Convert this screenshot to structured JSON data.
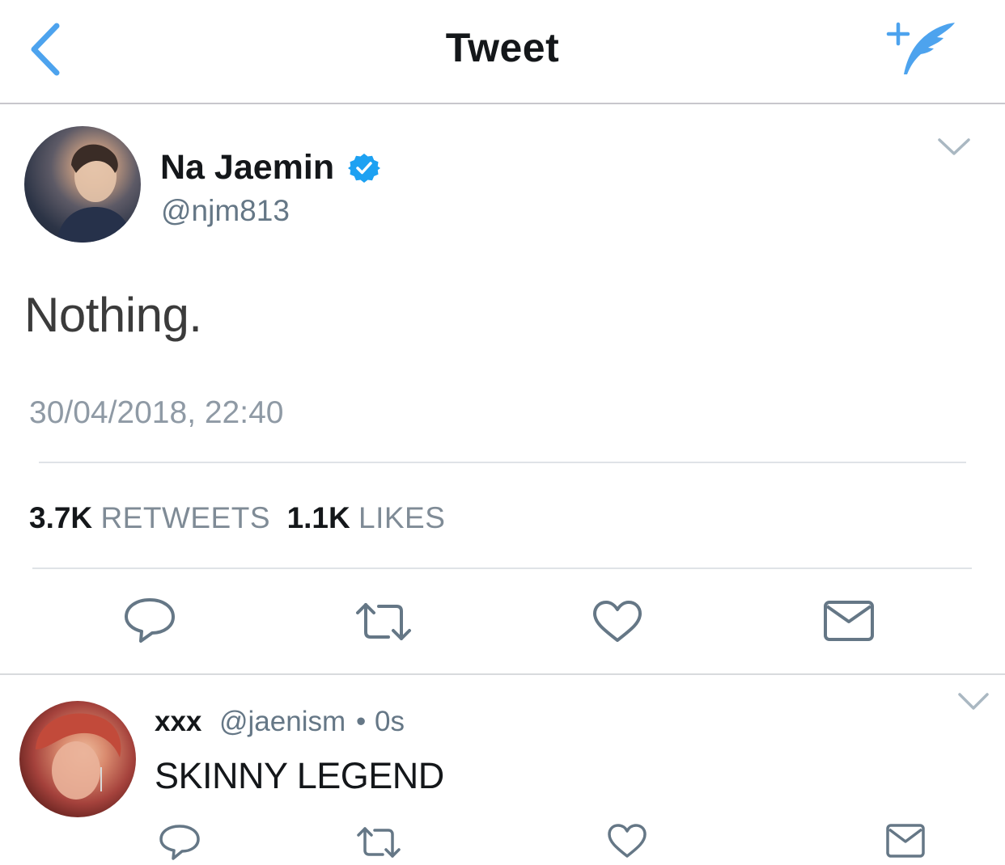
{
  "nav": {
    "title": "Tweet",
    "back_icon": "chevron-left-icon",
    "compose_icon": "compose-quill-icon",
    "accent": "#4da3ee"
  },
  "tweet": {
    "author_name": "Na Jaemin",
    "verified": true,
    "handle": "@njm813",
    "text": "Nothing.",
    "timestamp": "30/04/2018, 22:40",
    "retweet_count": "3.7K",
    "retweet_label": "RETWEETS",
    "like_count": "1.1K",
    "like_label": "LIKES",
    "actions": [
      "reply-icon",
      "retweet-icon",
      "heart-icon",
      "envelope-icon"
    ]
  },
  "reply": {
    "author_name": "xxx",
    "handle": "@jaenism",
    "separator": "•",
    "time": "0s",
    "text": "SKINNY LEGEND",
    "actions": [
      "reply-icon",
      "retweet-icon",
      "heart-icon",
      "envelope-icon"
    ]
  },
  "colors": {
    "verified_blue": "#1da1f2",
    "secondary_text": "#657786",
    "icon_gray": "#657786"
  }
}
